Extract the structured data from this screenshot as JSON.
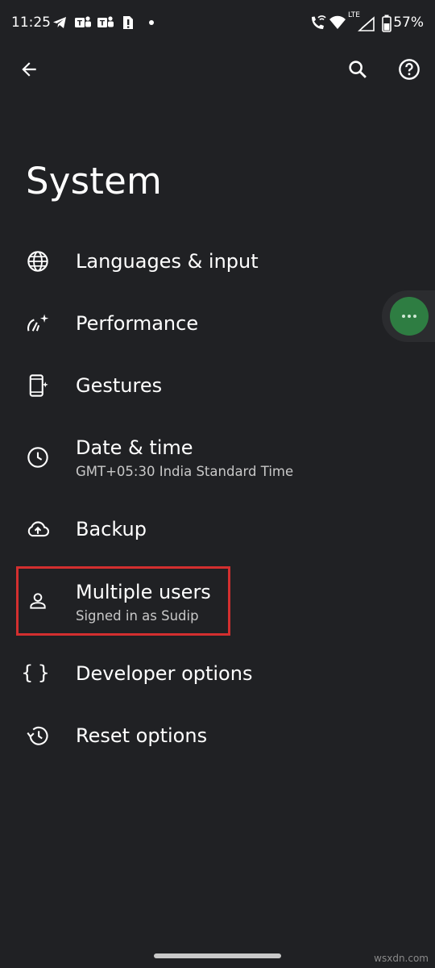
{
  "status_bar": {
    "time": "11:25",
    "battery": "57%",
    "network": "LTE"
  },
  "page": {
    "title": "System"
  },
  "items": [
    {
      "title": "Languages & input",
      "icon": "globe-icon"
    },
    {
      "title": "Performance",
      "icon": "gauge-sparkle-icon"
    },
    {
      "title": "Gestures",
      "icon": "phone-sparkle-icon"
    },
    {
      "title": "Date & time",
      "subtitle": "GMT+05:30 India Standard Time",
      "icon": "clock-icon"
    },
    {
      "title": "Backup",
      "icon": "cloud-upload-icon"
    },
    {
      "title": "Multiple users",
      "subtitle": "Signed in as Sudip",
      "icon": "person-icon"
    },
    {
      "title": "Developer options",
      "icon": "braces-icon"
    },
    {
      "title": "Reset options",
      "icon": "history-icon"
    }
  ],
  "colors": {
    "background": "#202124",
    "highlight": "#d32f2f",
    "bubble": "#2e7d42"
  },
  "watermark": "wsxdn.com"
}
